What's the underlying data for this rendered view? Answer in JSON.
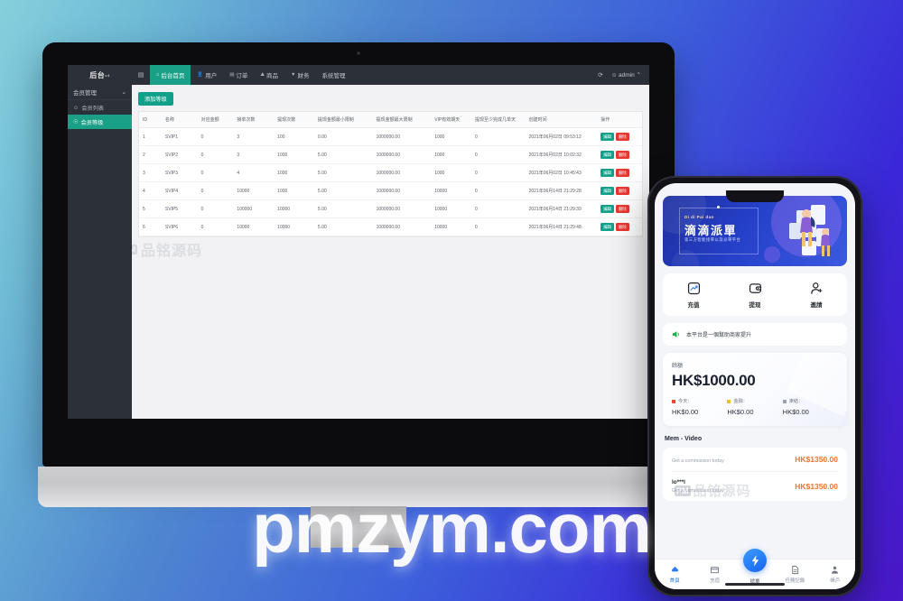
{
  "background": {
    "from": "#86cfdd",
    "to": "#4a18c8"
  },
  "watermark": {
    "big": "pmzym.com",
    "badge": "PM",
    "brand": "品铭源码",
    "domain": "pmzym.com"
  },
  "admin": {
    "logo": "后台",
    "logo_sup": "v4",
    "hamburger_icon": "menu-icon",
    "nav": [
      {
        "label": "后台首页",
        "icon": "home-icon",
        "active": true
      },
      {
        "label": "用户",
        "icon": "user-icon",
        "active": false
      },
      {
        "label": "订单",
        "icon": "order-icon",
        "active": false
      },
      {
        "label": "商品",
        "icon": "cart-icon",
        "active": false
      },
      {
        "label": "财务",
        "icon": "finance-icon",
        "active": false
      },
      {
        "label": "系统管理",
        "icon": "",
        "active": false
      }
    ],
    "topright": {
      "refresh_icon": "refresh-icon",
      "user_icon": "user-icon",
      "user": "admin",
      "caret": "⌃"
    },
    "sidebar": {
      "group": "会员管理",
      "group_caret": "⌄",
      "items": [
        {
          "label": "会员列表",
          "icon": "user-icon",
          "active": false
        },
        {
          "label": "会员等级",
          "icon": "level-icon",
          "active": true
        }
      ]
    },
    "toolbar": {
      "add_label": "添加等级"
    },
    "table": {
      "columns": [
        "ID",
        "名称",
        "对应金额",
        "接单次数",
        "提现次数",
        "提现金额最小限制",
        "提现金额最大限制",
        "VIP有效期天",
        "提现至少完成几单天",
        "创建时间",
        "操作"
      ],
      "rows": [
        {
          "id": "1",
          "name": "SVIP1",
          "amount": "0",
          "orders": "3",
          "withdraws": "100",
          "min": "0.00",
          "max": "1000000.00",
          "vip_days": "1000",
          "min_orders": "0",
          "created": "2021年06月02日 09:53:12",
          "edit": "编辑",
          "delete": "删除"
        },
        {
          "id": "2",
          "name": "SVIP2",
          "amount": "0",
          "orders": "3",
          "withdraws": "1000",
          "min": "5.00",
          "max": "1000000.00",
          "vip_days": "1000",
          "min_orders": "0",
          "created": "2021年06月02日 10:02:32",
          "edit": "编辑",
          "delete": "删除"
        },
        {
          "id": "3",
          "name": "SVIP3",
          "amount": "0",
          "orders": "4",
          "withdraws": "1000",
          "min": "5.00",
          "max": "1000000.00",
          "vip_days": "1000",
          "min_orders": "0",
          "created": "2021年06月02日 10:45:43",
          "edit": "编辑",
          "delete": "删除"
        },
        {
          "id": "4",
          "name": "SVIP4",
          "amount": "0",
          "orders": "10000",
          "withdraws": "1000",
          "min": "5.00",
          "max": "1000000.00",
          "vip_days": "10000",
          "min_orders": "0",
          "created": "2021年06月14日 21:29:28",
          "edit": "编辑",
          "delete": "删除"
        },
        {
          "id": "5",
          "name": "SVIP5",
          "amount": "0",
          "orders": "100000",
          "withdraws": "10000",
          "min": "5.00",
          "max": "1000000.00",
          "vip_days": "10000",
          "min_orders": "0",
          "created": "2021年06月14日 21:29:39",
          "edit": "编辑",
          "delete": "删除"
        },
        {
          "id": "6",
          "name": "SVIP6",
          "amount": "0",
          "orders": "10000",
          "withdraws": "10000",
          "min": "5.00",
          "max": "1000000.00",
          "vip_days": "10000",
          "min_orders": "0",
          "created": "2021年06月14日 21:29:48",
          "edit": "编辑",
          "delete": "删除"
        }
      ]
    },
    "colors": {
      "accent": "#12a08a",
      "danger": "#e8352e",
      "chrome": "#2c3038"
    }
  },
  "phone": {
    "banner": {
      "en": "Di di Pai dan",
      "cn": "滴滴派單",
      "sub": "第三方智能接單以及派單平台"
    },
    "actions": [
      {
        "label": "充值",
        "icon": "chart-up-icon"
      },
      {
        "label": "提现",
        "icon": "wallet-icon"
      },
      {
        "label": "邀請",
        "icon": "user-add-icon"
      }
    ],
    "notice": {
      "icon": "speaker-icon",
      "text": "本平台是一個幫助商家提升"
    },
    "balance": {
      "label": "餘額",
      "amount": "HK$1000.00",
      "stats": [
        {
          "label": "今天：",
          "value": "HK$0.00",
          "color": "#f0453a"
        },
        {
          "label": "金融：",
          "value": "HK$0.00",
          "color": "#f3c02c"
        },
        {
          "label": "凍結：",
          "value": "HK$0.00",
          "color": "#9aa0ad"
        }
      ]
    },
    "mem": {
      "heading": "Mem - Video",
      "rows": [
        {
          "name": "",
          "desc": "Get a commission today",
          "amount": "HK$1350.00"
        },
        {
          "name": "lo***l",
          "desc": "Get a commission today",
          "amount": "HK$1350.00"
        }
      ]
    },
    "tabs": [
      {
        "label": "首頁",
        "icon": "home-icon",
        "active": true,
        "center": false
      },
      {
        "label": "充值",
        "icon": "card-icon",
        "active": false,
        "center": false
      },
      {
        "label": "搶單",
        "icon": "bolt-icon",
        "active": false,
        "center": true
      },
      {
        "label": "任務記錄",
        "icon": "doc-icon",
        "active": false,
        "center": false
      },
      {
        "label": "帳戶",
        "icon": "account-icon",
        "active": false,
        "center": false
      }
    ]
  }
}
